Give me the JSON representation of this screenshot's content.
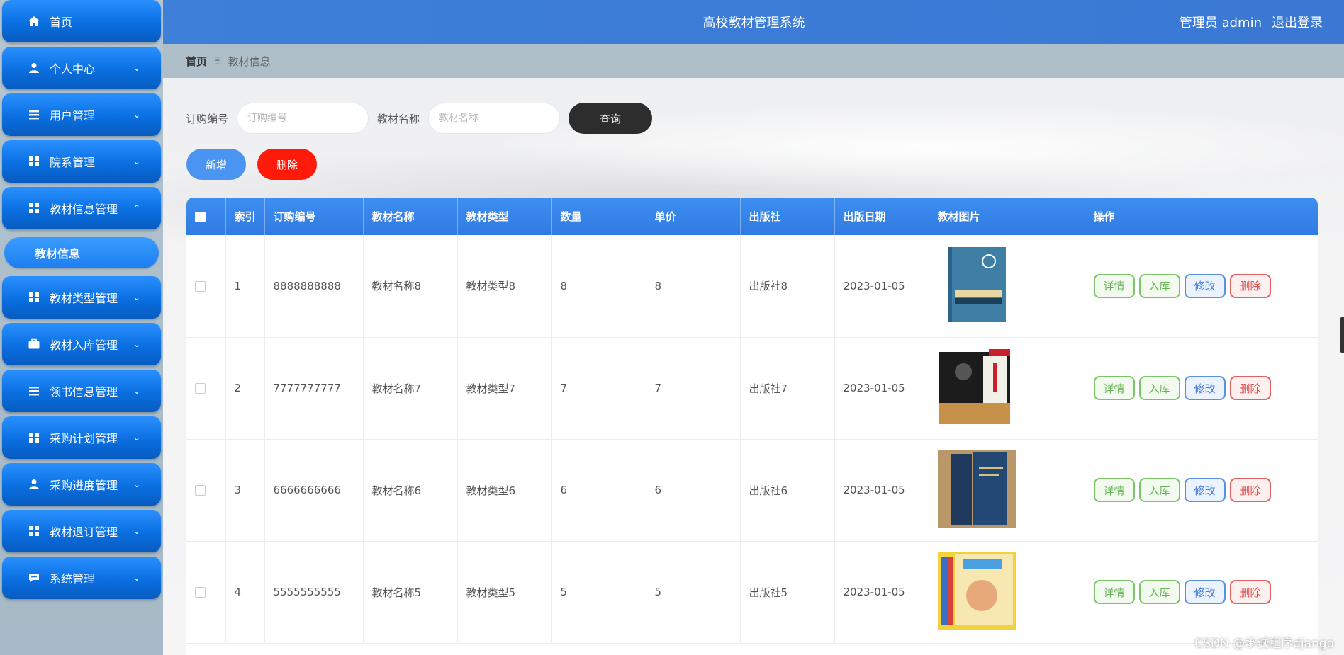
{
  "app": {
    "title": "高校教材管理系统"
  },
  "user": {
    "label": "管理员 admin",
    "logout": "退出登录"
  },
  "breadcrumb": {
    "home": "首页",
    "sep": "Ξ",
    "current": "教材信息"
  },
  "sidebar": {
    "items": [
      {
        "label": "首页",
        "icon": "home-icon",
        "caret": ""
      },
      {
        "label": "个人中心",
        "icon": "person-icon",
        "caret": "⌄"
      },
      {
        "label": "用户管理",
        "icon": "list-icon",
        "caret": "⌄"
      },
      {
        "label": "院系管理",
        "icon": "grid-icon",
        "caret": "⌄"
      },
      {
        "label": "教材信息管理",
        "icon": "grid-icon",
        "caret": "⌃"
      },
      {
        "label": "教材类型管理",
        "icon": "grid-icon",
        "caret": "⌄"
      },
      {
        "label": "教材入库管理",
        "icon": "briefcase-icon",
        "caret": "⌄"
      },
      {
        "label": "领书信息管理",
        "icon": "list-icon",
        "caret": "⌄"
      },
      {
        "label": "采购计划管理",
        "icon": "grid-icon",
        "caret": "⌄"
      },
      {
        "label": "采购进度管理",
        "icon": "person-icon",
        "caret": "⌄"
      },
      {
        "label": "教材退订管理",
        "icon": "grid-icon",
        "caret": "⌄"
      },
      {
        "label": "系统管理",
        "icon": "chat-icon",
        "caret": "⌄"
      }
    ],
    "subitem": "教材信息"
  },
  "search": {
    "order_label": "订购编号",
    "order_placeholder": "订购编号",
    "name_label": "教材名称",
    "name_placeholder": "教材名称",
    "query_button": "查询"
  },
  "actions": {
    "add": "新增",
    "delete": "删除"
  },
  "table": {
    "headers": [
      "索引",
      "订购编号",
      "教材名称",
      "教材类型",
      "数量",
      "单价",
      "出版社",
      "出版日期",
      "教材图片",
      "操作"
    ],
    "rows": [
      {
        "index": "1",
        "order_no": "8888888888",
        "name": "教材名称8",
        "type": "教材类型8",
        "qty": "8",
        "price": "8",
        "publisher": "出版社8",
        "date": "2023-01-05"
      },
      {
        "index": "2",
        "order_no": "7777777777",
        "name": "教材名称7",
        "type": "教材类型7",
        "qty": "7",
        "price": "7",
        "publisher": "出版社7",
        "date": "2023-01-05"
      },
      {
        "index": "3",
        "order_no": "6666666666",
        "name": "教材名称6",
        "type": "教材类型6",
        "qty": "6",
        "price": "6",
        "publisher": "出版社6",
        "date": "2023-01-05"
      },
      {
        "index": "4",
        "order_no": "5555555555",
        "name": "教材名称5",
        "type": "教材类型5",
        "qty": "5",
        "price": "5",
        "publisher": "出版社5",
        "date": "2023-01-05"
      }
    ],
    "row_buttons": {
      "detail": "详情",
      "stock_in": "入库",
      "edit": "修改",
      "delete": "删除"
    }
  },
  "watermark": "CSDN @承诚程序django"
}
